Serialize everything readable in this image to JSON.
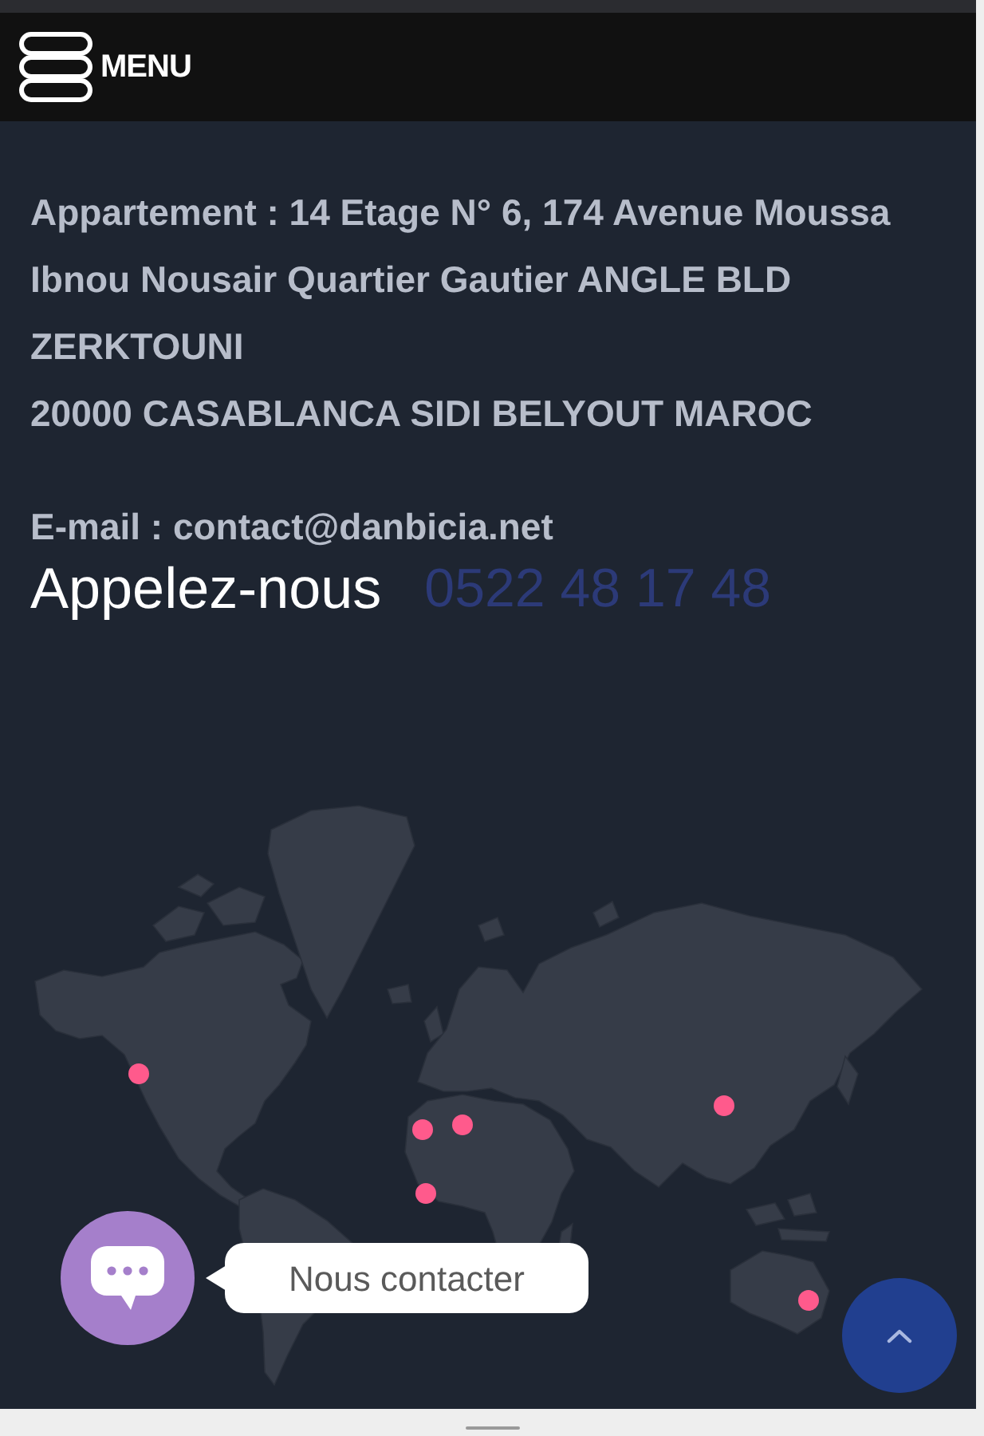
{
  "header": {
    "menu_label": "MENU"
  },
  "address": {
    "lines": [
      "Appartement : 14 Etage N° 6, 174 Avenue Moussa",
      "Ibnou Nousair Quartier Gautier ANGLE BLD",
      "ZERKTOUNI",
      "20000 CASABLANCA SIDI BELYOUT MAROC"
    ]
  },
  "email": "E-mail : contact@danbicia.net",
  "call": {
    "label": "Appelez-nous",
    "phone": "0522 48 17 48"
  },
  "chat": {
    "tooltip": "Nous contacter"
  }
}
